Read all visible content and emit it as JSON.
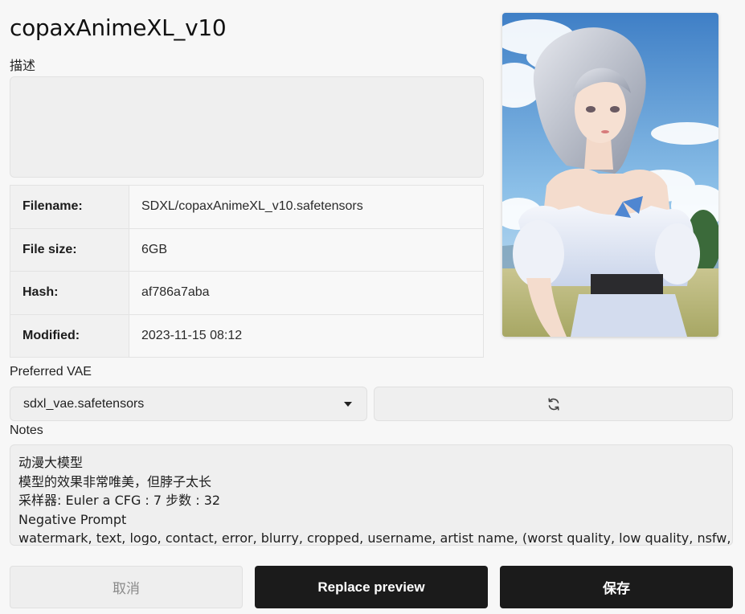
{
  "model": {
    "title": "copaxAnimeXL_v10",
    "description_label": "描述",
    "description": ""
  },
  "info_rows": [
    {
      "key": "Filename:",
      "value": "SDXL/copaxAnimeXL_v10.safetensors"
    },
    {
      "key": "File size:",
      "value": "6GB"
    },
    {
      "key": "Hash:",
      "value": "af786a7aba"
    },
    {
      "key": "Modified:",
      "value": "2023-11-15 08:12"
    }
  ],
  "vae": {
    "label": "Preferred VAE",
    "selected": "sdxl_vae.safetensors",
    "refresh_icon": "refresh-icon",
    "dropdown_icon": "caret-down-icon"
  },
  "notes": {
    "label": "Notes",
    "lines": [
      "动漫大模型",
      "模型的效果非常唯美，但脖子太长",
      "采样器: Euler a CFG : 7 步数 : 32",
      "Negative Prompt",
      "watermark, text, logo, contact, error, blurry, cropped, username, artist name, (worst quality, low quality, nsfw,"
    ]
  },
  "buttons": {
    "cancel": "取消",
    "replace_preview": "Replace preview",
    "save": "保存"
  },
  "preview_image": {
    "subject": "anime-style girl with silver hair in white off-shoulder dress, blue sky and meadow",
    "icon": "preview-image"
  },
  "colors": {
    "primary_button": "#1b1b1b",
    "background": "#f7f7f7",
    "field_bg": "#efefef"
  }
}
